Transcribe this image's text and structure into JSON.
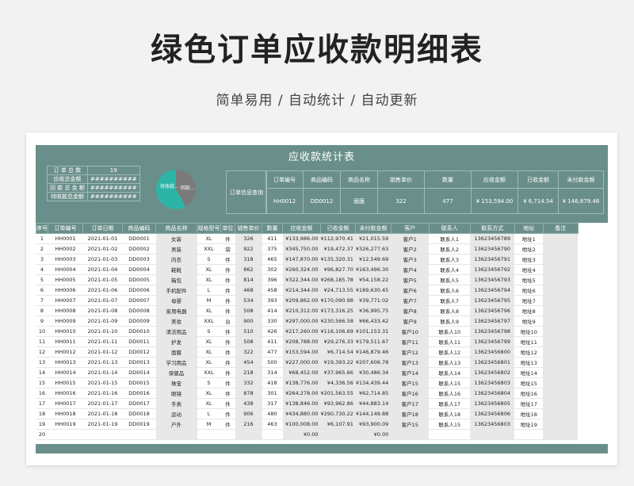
{
  "header": {
    "title": "绿色订单应收款明细表",
    "subtitle": "简单易用 / 自动统计 / 自动更新"
  },
  "sheet": {
    "title": "应收款统计表",
    "summary": {
      "rows": [
        {
          "label": "订 单 总 数",
          "value": "19"
        },
        {
          "label": "应收总金额",
          "value": "##########"
        },
        {
          "label": "回 款 总 金 额",
          "value": "##########"
        },
        {
          "label": "待收款总金额",
          "value": "##########"
        }
      ]
    },
    "donut": {
      "label_a": "待收款...",
      "label_b": "回款...",
      "paid_fraction": 0.42,
      "colors": {
        "teal": "#2cb5a6",
        "gray": "#7a7a7a"
      }
    },
    "query": {
      "label": "订单信息查询",
      "headers": [
        "订单编号",
        "商品编码",
        "商品名称",
        "销售单价",
        "数量",
        "应收金额",
        "已收金额",
        "未付款金额"
      ],
      "values": [
        "HH0012",
        "DD0012",
        "面膜",
        "322",
        "477",
        "¥ 153,594.00",
        "¥ 6,714.54",
        "¥ 146,879.46"
      ]
    },
    "table": {
      "headers": [
        "序号",
        "订单编号",
        "订单日期",
        "商品编码",
        "商品名称",
        "规格型号",
        "单位",
        "销售单价",
        "数量",
        "应收金额",
        "已收金额",
        "未付款金额",
        "客户",
        "联系人",
        "联系方式",
        "地址",
        "备注"
      ],
      "rows": [
        [
          "1",
          "HH0001",
          "2021-01-01",
          "DD0001",
          "女装",
          "XL",
          "件",
          "326",
          "411",
          "¥133,986.00",
          "¥112,970.41",
          "¥21,015.59",
          "客户1",
          "联系人1",
          "13623456789",
          "地址1",
          ""
        ],
        [
          "2",
          "HH0002",
          "2021-01-02",
          "DD0002",
          "男装",
          "XXL",
          "袋",
          "922",
          "375",
          "¥345,750.00",
          "¥19,472.37",
          "¥326,277.63",
          "客户2",
          "联系人2",
          "13623456790",
          "地址2",
          ""
        ],
        [
          "3",
          "HH0003",
          "2021-01-03",
          "DD0003",
          "内衣",
          "S",
          "件",
          "318",
          "465",
          "¥147,870.00",
          "¥135,320.31",
          "¥12,549.69",
          "客户3",
          "联系人3",
          "13623456791",
          "地址3",
          ""
        ],
        [
          "4",
          "HH0004",
          "2021-01-04",
          "DD0004",
          "鞋靴",
          "XL",
          "件",
          "862",
          "302",
          "¥260,324.00",
          "¥96,827.70",
          "¥163,496.30",
          "客户4",
          "联系人4",
          "13623456792",
          "地址4",
          ""
        ],
        [
          "5",
          "HH0005",
          "2021-01-05",
          "DD0005",
          "箱包",
          "XL",
          "件",
          "814",
          "396",
          "¥322,344.00",
          "¥268,185.78",
          "¥54,158.22",
          "客户5",
          "联系人5",
          "13623456793",
          "地址5",
          ""
        ],
        [
          "6",
          "HH0006",
          "2021-01-06",
          "DD0006",
          "手机配件",
          "L",
          "件",
          "468",
          "458",
          "¥214,344.00",
          "¥24,713.55",
          "¥189,630.45",
          "客户6",
          "联系人6",
          "13623456794",
          "地址6",
          ""
        ],
        [
          "7",
          "HH0007",
          "2021-01-07",
          "DD0007",
          "母婴",
          "M",
          "件",
          "534",
          "393",
          "¥209,862.00",
          "¥170,090.98",
          "¥39,771.02",
          "客户7",
          "联系人7",
          "13623456795",
          "地址7",
          ""
        ],
        [
          "8",
          "HH0008",
          "2021-01-08",
          "DD0008",
          "家用电器",
          "XL",
          "件",
          "508",
          "414",
          "¥210,312.00",
          "¥173,316.25",
          "¥36,995.75",
          "客户8",
          "联系人8",
          "13623456796",
          "地址8",
          ""
        ],
        [
          "9",
          "HH0009",
          "2021-01-09",
          "DD0009",
          "美妆",
          "XXL",
          "台",
          "900",
          "330",
          "¥297,000.00",
          "¥230,566.58",
          "¥66,433.42",
          "客户9",
          "联系人9",
          "13623456797",
          "地址9",
          ""
        ],
        [
          "10",
          "HH0010",
          "2021-01-10",
          "DD0010",
          "清洁用品",
          "S",
          "件",
          "510",
          "426",
          "¥217,260.00",
          "¥116,106.69",
          "¥101,153.31",
          "客户10",
          "联系人10",
          "13623456798",
          "地址10",
          ""
        ],
        [
          "11",
          "HH0011",
          "2021-01-11",
          "DD0011",
          "护发",
          "XL",
          "件",
          "508",
          "411",
          "¥208,788.00",
          "¥29,276.33",
          "¥179,511.67",
          "客户11",
          "联系人11",
          "13623456799",
          "地址11",
          ""
        ],
        [
          "12",
          "HH0012",
          "2021-01-12",
          "DD0012",
          "面膜",
          "XL",
          "件",
          "322",
          "477",
          "¥153,594.00",
          "¥6,714.54",
          "¥146,879.46",
          "客户12",
          "联系人12",
          "13623456800",
          "地址12",
          ""
        ],
        [
          "13",
          "HH0013",
          "2021-01-13",
          "DD0013",
          "学习用品",
          "XL",
          "件",
          "454",
          "500",
          "¥227,000.00",
          "¥19,393.22",
          "¥207,606.78",
          "客户13",
          "联系人13",
          "13623456801",
          "地址13",
          ""
        ],
        [
          "14",
          "HH0014",
          "2021-01-14",
          "DD0014",
          "保健品",
          "XXL",
          "件",
          "218",
          "314",
          "¥68,452.00",
          "¥37,965.66",
          "¥30,486.34",
          "客户14",
          "联系人14",
          "13623456802",
          "地址14",
          ""
        ],
        [
          "15",
          "HH0015",
          "2021-01-15",
          "DD0015",
          "珠宝",
          "S",
          "件",
          "332",
          "418",
          "¥138,776.00",
          "¥4,336.56",
          "¥134,439.44",
          "客户15",
          "联系人15",
          "13623456803",
          "地址15",
          ""
        ],
        [
          "16",
          "HH0016",
          "2021-01-16",
          "DD0016",
          "眼镜",
          "XL",
          "件",
          "878",
          "301",
          "¥264,278.00",
          "¥201,563.55",
          "¥62,714.85",
          "客户16",
          "联系人16",
          "13623456804",
          "地址16",
          ""
        ],
        [
          "17",
          "HH0017",
          "2021-01-17",
          "DD0017",
          "手表",
          "XL",
          "件",
          "438",
          "317",
          "¥138,846.00",
          "¥93,962.86",
          "¥44,883.14",
          "客户17",
          "联系人17",
          "13623456805",
          "地址17",
          ""
        ],
        [
          "18",
          "HH0018",
          "2021-01-18",
          "DD0018",
          "运动",
          "L",
          "件",
          "906",
          "480",
          "¥434,880.00",
          "¥290,730.22",
          "¥144,149.88",
          "客户18",
          "联系人18",
          "13623456806",
          "地址18",
          ""
        ],
        [
          "19",
          "HH0019",
          "2021-01-19",
          "DD0019",
          "户外",
          "M",
          "件",
          "216",
          "463",
          "¥100,008.00",
          "¥6,107.91",
          "¥93,900.09",
          "客户15",
          "联系人15",
          "13623456803",
          "地址19",
          ""
        ],
        [
          "20",
          "",
          "",
          "",
          "",
          "",
          "",
          "",
          "",
          "¥0.00",
          "",
          "¥0.00",
          "",
          "",
          "",
          "",
          ""
        ]
      ]
    }
  }
}
